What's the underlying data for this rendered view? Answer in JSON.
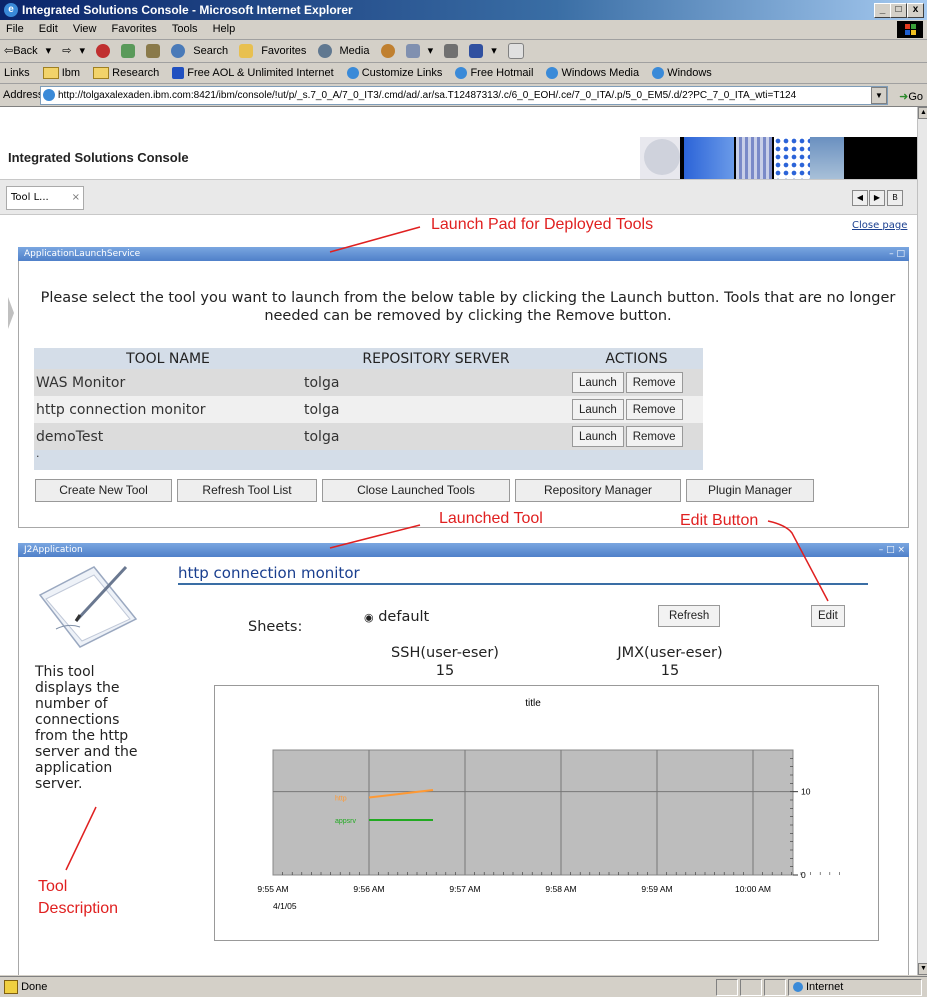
{
  "window": {
    "title": "Integrated Solutions Console - Microsoft Internet Explorer",
    "min": "_",
    "max": "□",
    "close": "x"
  },
  "menu": [
    "File",
    "Edit",
    "View",
    "Favorites",
    "Tools",
    "Help"
  ],
  "toolbar": {
    "back": "⇦Back",
    "back_dd": "▾",
    "forward": "⇨",
    "fwd_dd": "▾",
    "search": "Search",
    "favorites": "Favorites",
    "media": "Media",
    "media_dd": "▾",
    "w_dd": "▾"
  },
  "links": {
    "label": "Links",
    "items": [
      "Ibm",
      "Research",
      "Free AOL & Unlimited Internet",
      "Customize Links",
      "Free Hotmail",
      "Windows Media",
      "Windows"
    ]
  },
  "address": {
    "label": "Address",
    "value": "http://tolgaxalexaden.ibm.com:8421/ibm/console/!ut/p/_s.7_0_A/7_0_IT3/.cmd/ad/.ar/sa.T12487313/.c/6_0_EOH/.ce/7_0_ITA/.p/5_0_EM5/.d/2?PC_7_0_ITA_wti=T124",
    "go": "Go"
  },
  "console": {
    "title": "Integrated Solutions Console",
    "tab_label": "Tool L...",
    "tab_close": "×",
    "close_page": "Close page",
    "nav": {
      "prev": "◀",
      "next": "▶",
      "menu": "B"
    }
  },
  "launch_portlet": {
    "header": "ApplicationLaunchService",
    "controls": "– □",
    "instruction": "Please select the tool you want to launch from the below table by clicking the Launch button. Tools that are no longer needed can be removed by clicking the Remove button.",
    "columns": [
      "TOOL NAME",
      "REPOSITORY SERVER",
      "ACTIONS"
    ],
    "rows": [
      {
        "name": "WAS Monitor",
        "server": "tolga"
      },
      {
        "name": "http connection monitor",
        "server": "tolga"
      },
      {
        "name": "demoTest",
        "server": "tolga"
      }
    ],
    "launch_label": "Launch",
    "remove_label": "Remove",
    "footer_dot": ".",
    "buttons": [
      "Create New Tool",
      "Refresh Tool List",
      "Close Launched Tools",
      "Repository Manager",
      "Plugin Manager"
    ]
  },
  "app_portlet": {
    "header": "J2Application",
    "controls": "– □ ×",
    "title": "http connection monitor",
    "description": "This tool displays the number of connections from the http server and the application server.",
    "sheets_label": "Sheets:",
    "sheet_option": "default",
    "refresh": "Refresh",
    "edit": "Edit",
    "metrics": [
      {
        "label": "SSH(user-eser)",
        "value": "15"
      },
      {
        "label": "JMX(user-eser)",
        "value": "15"
      }
    ]
  },
  "chart_data": {
    "type": "line",
    "title": "title",
    "x_ticks": [
      "9:55 AM",
      "9:56 AM",
      "9:57 AM",
      "9:58 AM",
      "9:59 AM",
      "10:00 AM"
    ],
    "x_sub": "4/1/05",
    "y_ticks": [
      "0",
      "10"
    ],
    "ylim": [
      0,
      15
    ],
    "grid": true,
    "series": [
      {
        "name": "http",
        "color": "#ff9933",
        "points": [
          [
            "9:56 AM",
            9.3
          ],
          [
            "9:56:40 AM",
            10.2
          ]
        ]
      },
      {
        "name": "appsrv",
        "color": "#22aa22",
        "points": [
          [
            "9:56 AM",
            6.6
          ],
          [
            "9:56:40 AM",
            6.6
          ]
        ]
      }
    ]
  },
  "annotations": {
    "launch_pad": "Launch Pad for Deployed Tools",
    "launched_tool": "Launched Tool",
    "edit_button": "Edit Button",
    "tool_desc_1": "Tool",
    "tool_desc_2": "Description"
  },
  "status": {
    "text": "Done",
    "zone": "Internet"
  }
}
